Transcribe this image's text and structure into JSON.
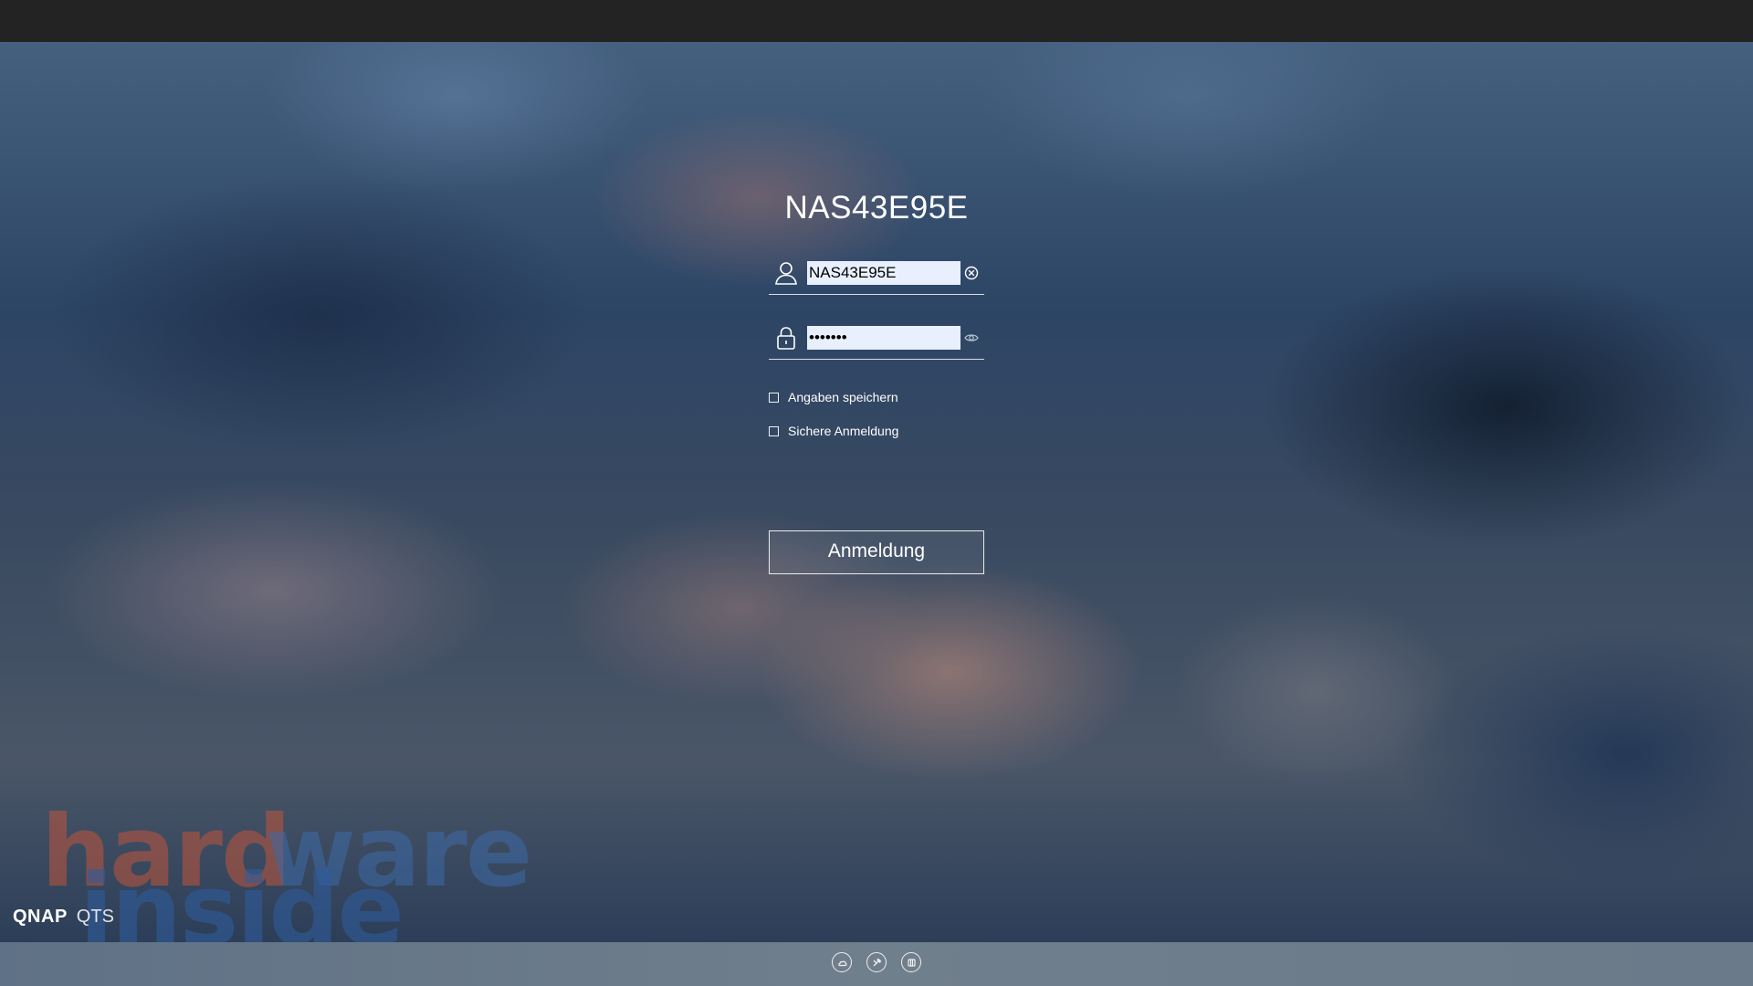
{
  "device_name": "NAS43E95E",
  "username": {
    "value": "NAS43E95E",
    "icon": "user-icon",
    "clear_icon": "clear-icon"
  },
  "password": {
    "value": "•••••••",
    "icon": "lock-icon",
    "toggle_icon": "eye-icon"
  },
  "options": {
    "remember_label": "Angaben speichern",
    "remember_checked": false,
    "secure_label": "Sichere Anmeldung",
    "secure_checked": false
  },
  "login_button_label": "Anmeldung",
  "branding": {
    "vendor": "QNAP",
    "os": "QTS"
  },
  "watermark": {
    "word_1a": "hard",
    "word_1b": "ware",
    "word_2": "inside"
  },
  "footer_icons": [
    "cloud-icon",
    "tools-icon",
    "app-icon"
  ],
  "colors": {
    "topbar": "#232323",
    "autofill_background": "#e8f0fe",
    "watermark_red": "#c0553a",
    "watermark_blue": "#3d6aa8"
  }
}
